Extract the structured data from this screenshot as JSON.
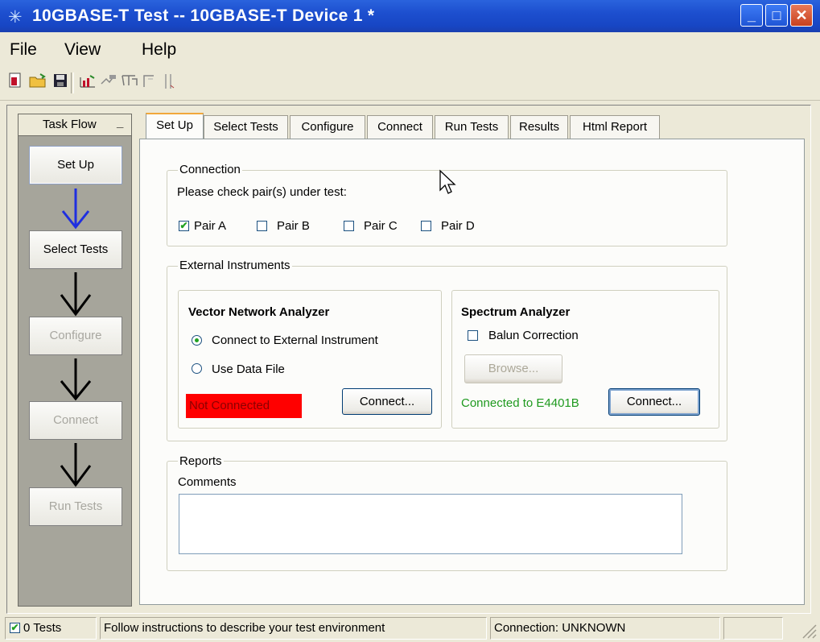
{
  "window": {
    "title": "10GBASE-T Test -- 10GBASE-T Device 1 *",
    "min_glyph": "_",
    "max_glyph": "□",
    "close_glyph": "✕"
  },
  "menu": [
    "File",
    "View",
    "Help"
  ],
  "toolbar_icons": [
    "new-icon",
    "open-icon",
    "save-icon",
    "chart-icon",
    "connect-icon",
    "filter-icon",
    "step-icon",
    "marker-icon"
  ],
  "taskflow": {
    "header": "Task Flow",
    "minimize": "_",
    "items": [
      {
        "label": "Set Up",
        "state": "active"
      },
      {
        "label": "Select Tests",
        "state": "enabled"
      },
      {
        "label": "Configure",
        "state": "disabled"
      },
      {
        "label": "Connect",
        "state": "disabled"
      },
      {
        "label": "Run Tests",
        "state": "disabled"
      }
    ],
    "arrow_colors": [
      "#1f2fe0",
      "#000000",
      "#000000",
      "#000000"
    ]
  },
  "tabs": [
    "Set Up",
    "Select Tests",
    "Configure",
    "Connect",
    "Run Tests",
    "Results",
    "Html Report"
  ],
  "selected_tab": "Set Up",
  "connection": {
    "legend": "Connection",
    "prompt": "Please check pair(s) under test:",
    "pairs": [
      {
        "label": "Pair A",
        "checked": true
      },
      {
        "label": "Pair B",
        "checked": false
      },
      {
        "label": "Pair C",
        "checked": false
      },
      {
        "label": "Pair D",
        "checked": false
      }
    ]
  },
  "external": {
    "legend": "External Instruments",
    "vna": {
      "title": "Vector Network Analyzer",
      "option_external": "Connect to External Instrument",
      "option_file": "Use Data File",
      "selected": "external",
      "status": "Not Connected",
      "connect": "Connect..."
    },
    "spectrum": {
      "title": "Spectrum Analyzer",
      "balun": "Balun Correction",
      "balun_checked": false,
      "browse": "Browse...",
      "status": "Connected to E4401B",
      "connect": "Connect..."
    }
  },
  "reports": {
    "legend": "Reports",
    "comments_label": "Comments",
    "comments_value": ""
  },
  "statusbar": {
    "tests": "0 Tests",
    "tests_checked": true,
    "message": "Follow instructions to describe your test environment",
    "connection": "Connection: UNKNOWN"
  },
  "colors": {
    "not_connected_bg": "#ff0000",
    "connected_text": "#1f9a1f",
    "tab_accent": "#f1a83b"
  }
}
